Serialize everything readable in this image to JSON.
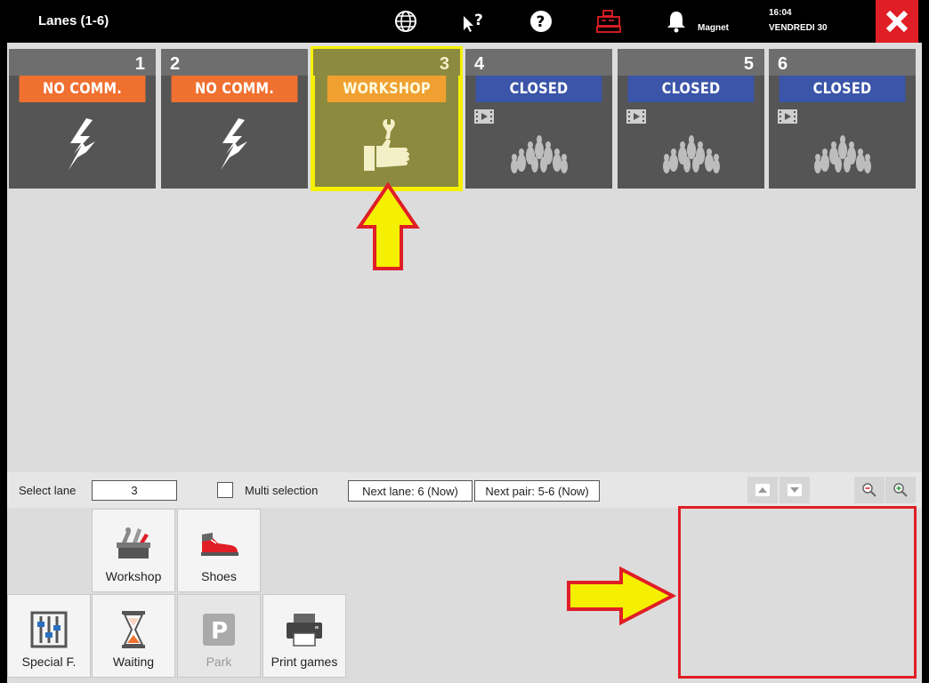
{
  "header": {
    "title": "Lanes (1-6)",
    "user": "Magnet",
    "time": "16:04",
    "date": "VENDREDI 30",
    "icons": [
      "globe-icon",
      "pointer-help-icon",
      "help-icon",
      "cash-register-icon",
      "bell-icon",
      "close-icon"
    ]
  },
  "lanes": [
    {
      "number": "1",
      "status": "NO COMM.",
      "status_color": "#f07030",
      "icon": "lightning-icon"
    },
    {
      "number": "2",
      "status": "NO COMM.",
      "status_color": "#f07030",
      "icon": "lightning-icon"
    },
    {
      "number": "3",
      "status": "WORKSHOP",
      "status_color": "#f0a030",
      "icon": "thumbs-up-wrench-icon",
      "selected": true
    },
    {
      "number": "4",
      "status": "CLOSED",
      "status_color": "#3b55a8",
      "icon": "bowling-pins-icon"
    },
    {
      "number": "5",
      "status": "CLOSED",
      "status_color": "#3b55a8",
      "icon": "bowling-pins-icon"
    },
    {
      "number": "6",
      "status": "CLOSED",
      "status_color": "#3b55a8",
      "icon": "bowling-pins-icon"
    }
  ],
  "controls": {
    "select_lane_label": "Select lane",
    "select_lane_value": "3",
    "multi_selection_label": "Multi selection",
    "next_lane": "Next lane: 6 (Now)",
    "next_pair": "Next pair: 5-6 (Now)"
  },
  "functions": {
    "workshop": "Workshop",
    "shoes": "Shoes",
    "special": "Special F.",
    "waiting": "Waiting",
    "park": "Park",
    "print": "Print games"
  },
  "colors": {
    "accent_red": "#e01e25",
    "highlight_yellow": "#f5f000"
  }
}
